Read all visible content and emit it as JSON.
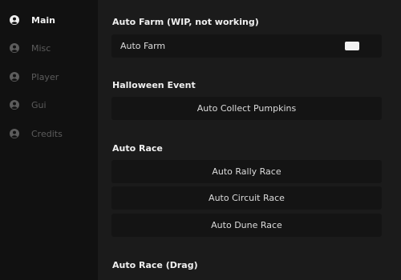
{
  "sidebar": {
    "items": [
      {
        "label": "Main",
        "icon": "user-icon",
        "active": true
      },
      {
        "label": "Misc",
        "icon": "user-icon",
        "active": false
      },
      {
        "label": "Player",
        "icon": "user-icon",
        "active": false
      },
      {
        "label": "Gui",
        "icon": "user-icon",
        "active": false
      },
      {
        "label": "Credits",
        "icon": "user-icon",
        "active": false
      }
    ]
  },
  "main": {
    "sections": [
      {
        "title": "Auto Farm (WIP, not working)"
      },
      {
        "title": "Halloween Event"
      },
      {
        "title": "Auto Race"
      },
      {
        "title": "Auto Race (Drag)"
      }
    ],
    "auto_farm_toggle": {
      "label": "Auto Farm",
      "state": "on"
    },
    "buttons": {
      "collect_pumpkins": "Auto Collect Pumpkins",
      "rally_race": "Auto Rally Race",
      "circuit_race": "Auto Circuit Race",
      "dune_race": "Auto Dune Race"
    }
  },
  "colors": {
    "sidebar_bg": "#111111",
    "panel_bg": "#1b1b1b",
    "row_bg": "#141414",
    "active_text": "#f0f0f0",
    "inactive_text": "#5c5c5c",
    "toggle_on": "#f2f2f2"
  }
}
